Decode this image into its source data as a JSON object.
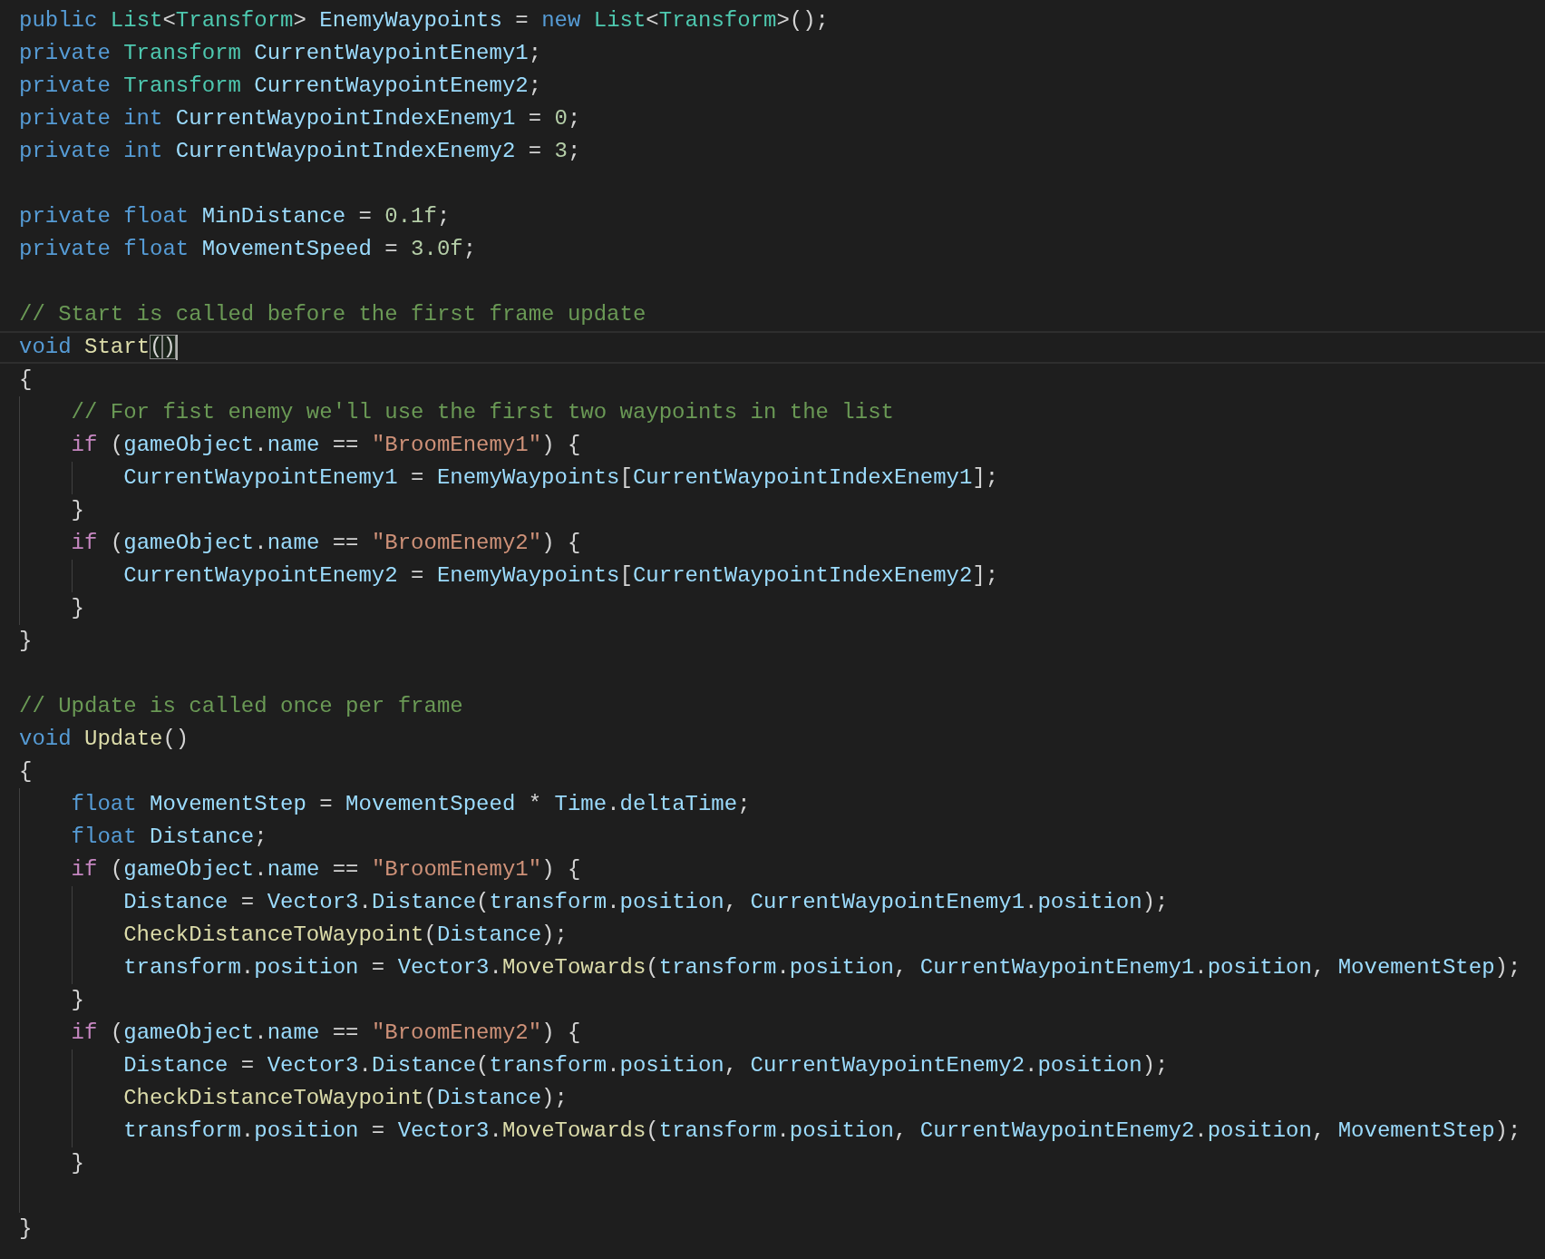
{
  "editor": {
    "lines": [
      {
        "kind": "code",
        "tokens": [
          {
            "text": "public ",
            "kind": "kw"
          },
          {
            "text": "List",
            "kind": "type"
          },
          {
            "text": "<",
            "kind": "p"
          },
          {
            "text": "Transform",
            "kind": "type"
          },
          {
            "text": "> ",
            "kind": "p"
          },
          {
            "text": "EnemyWaypoints",
            "kind": "var"
          },
          {
            "text": " = ",
            "kind": "p"
          },
          {
            "text": "new ",
            "kind": "kw"
          },
          {
            "text": "List",
            "kind": "type"
          },
          {
            "text": "<",
            "kind": "p"
          },
          {
            "text": "Transform",
            "kind": "type"
          },
          {
            "text": ">();",
            "kind": "p"
          }
        ]
      },
      {
        "kind": "code",
        "tokens": [
          {
            "text": "private ",
            "kind": "kw"
          },
          {
            "text": "Transform ",
            "kind": "type"
          },
          {
            "text": "CurrentWaypointEnemy1",
            "kind": "var"
          },
          {
            "text": ";",
            "kind": "p"
          }
        ]
      },
      {
        "kind": "code",
        "tokens": [
          {
            "text": "private ",
            "kind": "kw"
          },
          {
            "text": "Transform ",
            "kind": "type"
          },
          {
            "text": "CurrentWaypointEnemy2",
            "kind": "var"
          },
          {
            "text": ";",
            "kind": "p"
          }
        ]
      },
      {
        "kind": "code",
        "tokens": [
          {
            "text": "private int ",
            "kind": "kw"
          },
          {
            "text": "CurrentWaypointIndexEnemy1",
            "kind": "var"
          },
          {
            "text": " = ",
            "kind": "p"
          },
          {
            "text": "0",
            "kind": "num"
          },
          {
            "text": ";",
            "kind": "p"
          }
        ]
      },
      {
        "kind": "code",
        "tokens": [
          {
            "text": "private int ",
            "kind": "kw"
          },
          {
            "text": "CurrentWaypointIndexEnemy2",
            "kind": "var"
          },
          {
            "text": " = ",
            "kind": "p"
          },
          {
            "text": "3",
            "kind": "num"
          },
          {
            "text": ";",
            "kind": "p"
          }
        ]
      },
      {
        "kind": "blank"
      },
      {
        "kind": "code",
        "tokens": [
          {
            "text": "private float ",
            "kind": "kw"
          },
          {
            "text": "MinDistance",
            "kind": "var"
          },
          {
            "text": " = ",
            "kind": "p"
          },
          {
            "text": "0.1f",
            "kind": "num"
          },
          {
            "text": ";",
            "kind": "p"
          }
        ]
      },
      {
        "kind": "code",
        "tokens": [
          {
            "text": "private float ",
            "kind": "kw"
          },
          {
            "text": "MovementSpeed",
            "kind": "var"
          },
          {
            "text": " = ",
            "kind": "p"
          },
          {
            "text": "3.0f",
            "kind": "num"
          },
          {
            "text": ";",
            "kind": "p"
          }
        ]
      },
      {
        "kind": "blank"
      },
      {
        "kind": "code",
        "tokens": [
          {
            "text": "// Start is called before the first frame update",
            "kind": "com"
          }
        ]
      },
      {
        "kind": "code",
        "current": true,
        "tokens": [
          {
            "text": "void ",
            "kind": "kw"
          },
          {
            "text": "Start",
            "kind": "fn"
          },
          {
            "text": "(",
            "kind": "brk"
          },
          {
            "text": ")",
            "kind": "brk"
          }
        ]
      },
      {
        "kind": "code",
        "tokens": [
          {
            "text": "{",
            "kind": "p"
          }
        ]
      },
      {
        "kind": "code",
        "tokens": [
          {
            "text": "    // For fist enemy we'll use the first two waypoints in the list",
            "kind": "com"
          }
        ]
      },
      {
        "kind": "code",
        "tokens": [
          {
            "text": "    if",
            "kind": "ctl"
          },
          {
            "text": " (",
            "kind": "p"
          },
          {
            "text": "gameObject",
            "kind": "var"
          },
          {
            "text": ".",
            "kind": "p"
          },
          {
            "text": "name",
            "kind": "var"
          },
          {
            "text": " == ",
            "kind": "p"
          },
          {
            "text": "\"BroomEnemy1\"",
            "kind": "str"
          },
          {
            "text": ") {",
            "kind": "p"
          }
        ]
      },
      {
        "kind": "code",
        "tokens": [
          {
            "text": "        CurrentWaypointEnemy1",
            "kind": "var"
          },
          {
            "text": " = ",
            "kind": "p"
          },
          {
            "text": "EnemyWaypoints",
            "kind": "var"
          },
          {
            "text": "[",
            "kind": "p"
          },
          {
            "text": "CurrentWaypointIndexEnemy1",
            "kind": "var"
          },
          {
            "text": "];",
            "kind": "p"
          }
        ]
      },
      {
        "kind": "code",
        "tokens": [
          {
            "text": "    }",
            "kind": "p"
          }
        ]
      },
      {
        "kind": "code",
        "tokens": [
          {
            "text": "    if",
            "kind": "ctl"
          },
          {
            "text": " (",
            "kind": "p"
          },
          {
            "text": "gameObject",
            "kind": "var"
          },
          {
            "text": ".",
            "kind": "p"
          },
          {
            "text": "name",
            "kind": "var"
          },
          {
            "text": " == ",
            "kind": "p"
          },
          {
            "text": "\"BroomEnemy2\"",
            "kind": "str"
          },
          {
            "text": ") {",
            "kind": "p"
          }
        ]
      },
      {
        "kind": "code",
        "tokens": [
          {
            "text": "        CurrentWaypointEnemy2",
            "kind": "var"
          },
          {
            "text": " = ",
            "kind": "p"
          },
          {
            "text": "EnemyWaypoints",
            "kind": "var"
          },
          {
            "text": "[",
            "kind": "p"
          },
          {
            "text": "CurrentWaypointIndexEnemy2",
            "kind": "var"
          },
          {
            "text": "];",
            "kind": "p"
          }
        ]
      },
      {
        "kind": "code",
        "tokens": [
          {
            "text": "    }",
            "kind": "p"
          }
        ]
      },
      {
        "kind": "code",
        "tokens": [
          {
            "text": "}",
            "kind": "p"
          }
        ]
      },
      {
        "kind": "blank"
      },
      {
        "kind": "code",
        "tokens": [
          {
            "text": "// Update is called once per frame",
            "kind": "com"
          }
        ]
      },
      {
        "kind": "code",
        "tokens": [
          {
            "text": "void ",
            "kind": "kw"
          },
          {
            "text": "Update",
            "kind": "fn"
          },
          {
            "text": "()",
            "kind": "p"
          }
        ]
      },
      {
        "kind": "code",
        "tokens": [
          {
            "text": "{",
            "kind": "p"
          }
        ]
      },
      {
        "kind": "code",
        "tokens": [
          {
            "text": "    float ",
            "kind": "kw"
          },
          {
            "text": "MovementStep",
            "kind": "var"
          },
          {
            "text": " = ",
            "kind": "p"
          },
          {
            "text": "MovementSpeed",
            "kind": "var"
          },
          {
            "text": " * ",
            "kind": "p"
          },
          {
            "text": "Time",
            "kind": "var"
          },
          {
            "text": ".",
            "kind": "p"
          },
          {
            "text": "deltaTime",
            "kind": "var"
          },
          {
            "text": ";",
            "kind": "p"
          }
        ]
      },
      {
        "kind": "code",
        "tokens": [
          {
            "text": "    float ",
            "kind": "kw"
          },
          {
            "text": "Distance",
            "kind": "var"
          },
          {
            "text": ";",
            "kind": "p"
          }
        ]
      },
      {
        "kind": "code",
        "tokens": [
          {
            "text": "    if",
            "kind": "ctl"
          },
          {
            "text": " (",
            "kind": "p"
          },
          {
            "text": "gameObject",
            "kind": "var"
          },
          {
            "text": ".",
            "kind": "p"
          },
          {
            "text": "name",
            "kind": "var"
          },
          {
            "text": " == ",
            "kind": "p"
          },
          {
            "text": "\"BroomEnemy1\"",
            "kind": "str"
          },
          {
            "text": ") {",
            "kind": "p"
          }
        ]
      },
      {
        "kind": "code",
        "tokens": [
          {
            "text": "        Distance",
            "kind": "var"
          },
          {
            "text": " = ",
            "kind": "p"
          },
          {
            "text": "Vector3",
            "kind": "var"
          },
          {
            "text": ".",
            "kind": "p"
          },
          {
            "text": "Distance",
            "kind": "var"
          },
          {
            "text": "(",
            "kind": "p"
          },
          {
            "text": "transform",
            "kind": "var"
          },
          {
            "text": ".",
            "kind": "p"
          },
          {
            "text": "position",
            "kind": "var"
          },
          {
            "text": ", ",
            "kind": "p"
          },
          {
            "text": "CurrentWaypointEnemy1",
            "kind": "var"
          },
          {
            "text": ".",
            "kind": "p"
          },
          {
            "text": "position",
            "kind": "var"
          },
          {
            "text": ");",
            "kind": "p"
          }
        ]
      },
      {
        "kind": "code",
        "tokens": [
          {
            "text": "        CheckDistanceToWaypoint",
            "kind": "fn"
          },
          {
            "text": "(",
            "kind": "p"
          },
          {
            "text": "Distance",
            "kind": "var"
          },
          {
            "text": ");",
            "kind": "p"
          }
        ]
      },
      {
        "kind": "code",
        "tokens": [
          {
            "text": "        transform",
            "kind": "var"
          },
          {
            "text": ".",
            "kind": "p"
          },
          {
            "text": "position",
            "kind": "var"
          },
          {
            "text": " = ",
            "kind": "p"
          },
          {
            "text": "Vector3",
            "kind": "var"
          },
          {
            "text": ".",
            "kind": "p"
          },
          {
            "text": "MoveTowards",
            "kind": "fn"
          },
          {
            "text": "(",
            "kind": "p"
          },
          {
            "text": "transform",
            "kind": "var"
          },
          {
            "text": ".",
            "kind": "p"
          },
          {
            "text": "position",
            "kind": "var"
          },
          {
            "text": ", ",
            "kind": "p"
          },
          {
            "text": "CurrentWaypointEnemy1",
            "kind": "var"
          },
          {
            "text": ".",
            "kind": "p"
          },
          {
            "text": "position",
            "kind": "var"
          },
          {
            "text": ", ",
            "kind": "p"
          },
          {
            "text": "MovementStep",
            "kind": "var"
          },
          {
            "text": ");",
            "kind": "p"
          }
        ]
      },
      {
        "kind": "code",
        "tokens": [
          {
            "text": "    }",
            "kind": "p"
          }
        ]
      },
      {
        "kind": "code",
        "tokens": [
          {
            "text": "    if",
            "kind": "ctl"
          },
          {
            "text": " (",
            "kind": "p"
          },
          {
            "text": "gameObject",
            "kind": "var"
          },
          {
            "text": ".",
            "kind": "p"
          },
          {
            "text": "name",
            "kind": "var"
          },
          {
            "text": " == ",
            "kind": "p"
          },
          {
            "text": "\"BroomEnemy2\"",
            "kind": "str"
          },
          {
            "text": ") {",
            "kind": "p"
          }
        ]
      },
      {
        "kind": "code",
        "tokens": [
          {
            "text": "        Distance",
            "kind": "var"
          },
          {
            "text": " = ",
            "kind": "p"
          },
          {
            "text": "Vector3",
            "kind": "var"
          },
          {
            "text": ".",
            "kind": "p"
          },
          {
            "text": "Distance",
            "kind": "var"
          },
          {
            "text": "(",
            "kind": "p"
          },
          {
            "text": "transform",
            "kind": "var"
          },
          {
            "text": ".",
            "kind": "p"
          },
          {
            "text": "position",
            "kind": "var"
          },
          {
            "text": ", ",
            "kind": "p"
          },
          {
            "text": "CurrentWaypointEnemy2",
            "kind": "var"
          },
          {
            "text": ".",
            "kind": "p"
          },
          {
            "text": "position",
            "kind": "var"
          },
          {
            "text": ");",
            "kind": "p"
          }
        ]
      },
      {
        "kind": "code",
        "tokens": [
          {
            "text": "        CheckDistanceToWaypoint",
            "kind": "fn"
          },
          {
            "text": "(",
            "kind": "p"
          },
          {
            "text": "Distance",
            "kind": "var"
          },
          {
            "text": ");",
            "kind": "p"
          }
        ]
      },
      {
        "kind": "code",
        "tokens": [
          {
            "text": "        transform",
            "kind": "var"
          },
          {
            "text": ".",
            "kind": "p"
          },
          {
            "text": "position",
            "kind": "var"
          },
          {
            "text": " = ",
            "kind": "p"
          },
          {
            "text": "Vector3",
            "kind": "var"
          },
          {
            "text": ".",
            "kind": "p"
          },
          {
            "text": "MoveTowards",
            "kind": "fn"
          },
          {
            "text": "(",
            "kind": "p"
          },
          {
            "text": "transform",
            "kind": "var"
          },
          {
            "text": ".",
            "kind": "p"
          },
          {
            "text": "position",
            "kind": "var"
          },
          {
            "text": ", ",
            "kind": "p"
          },
          {
            "text": "CurrentWaypointEnemy2",
            "kind": "var"
          },
          {
            "text": ".",
            "kind": "p"
          },
          {
            "text": "position",
            "kind": "var"
          },
          {
            "text": ", ",
            "kind": "p"
          },
          {
            "text": "MovementStep",
            "kind": "var"
          },
          {
            "text": ");",
            "kind": "p"
          }
        ]
      },
      {
        "kind": "code",
        "tokens": [
          {
            "text": "    }",
            "kind": "p"
          }
        ]
      },
      {
        "kind": "blank"
      },
      {
        "kind": "code",
        "tokens": [
          {
            "text": "}",
            "kind": "p"
          }
        ]
      }
    ]
  }
}
